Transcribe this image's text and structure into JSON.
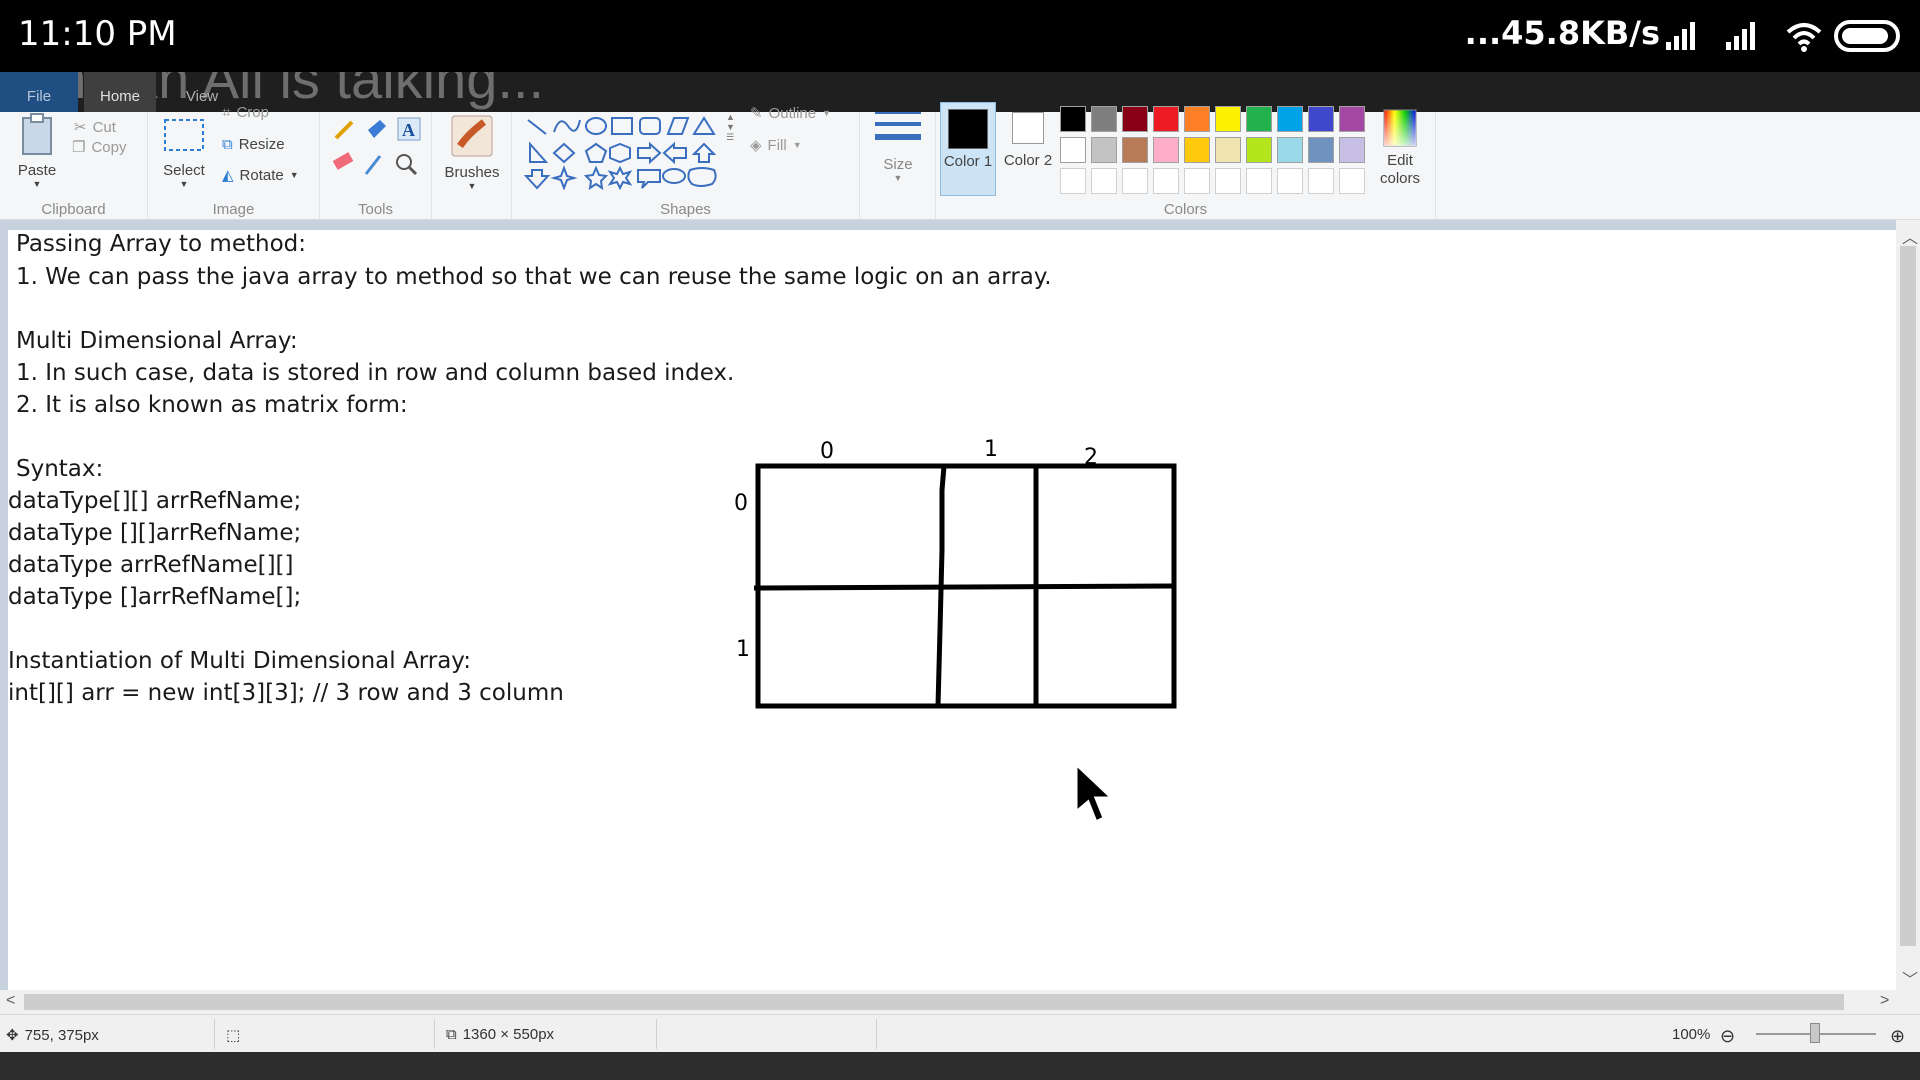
{
  "status_bar": {
    "time": "11:10 PM",
    "network_speed": "...45.8KB/s"
  },
  "ghost_banner": {
    "text": "Sheikh Ali is talking..."
  },
  "tabs": [
    {
      "label": "File"
    },
    {
      "label": "Home"
    },
    {
      "label": "View"
    }
  ],
  "ribbon": {
    "clipboard": {
      "paste": "Paste",
      "cut": "Cut",
      "copy": "Copy",
      "group": "Clipboard"
    },
    "image": {
      "select": "Select",
      "crop": "Crop",
      "resize": "Resize",
      "rotate": "Rotate",
      "group": "Image"
    },
    "tools": {
      "group": "Tools"
    },
    "brushes": {
      "label": "Brushes"
    },
    "shapes": {
      "outline": "Outline",
      "fill": "Fill",
      "group": "Shapes"
    },
    "size": {
      "label": "Size"
    },
    "colors": {
      "color1": "Color 1",
      "color2": "Color 2",
      "edit": "Edit colors",
      "group": "Colors",
      "color1_value": "#000000",
      "color2_value": "#ffffff",
      "palette_row1": [
        "#000000",
        "#7f7f7f",
        "#880015",
        "#ed1c24",
        "#ff7f27",
        "#fff200",
        "#22b14c",
        "#00a2e8",
        "#3f48cc",
        "#a349a4"
      ],
      "palette_row2": [
        "#ffffff",
        "#c3c3c3",
        "#b97a57",
        "#ffaec9",
        "#ffc90e",
        "#efe4b0",
        "#b5e61d",
        "#99d9ea",
        "#7092be",
        "#c8bfe7"
      ]
    }
  },
  "canvas": {
    "lines": [
      "Passing Array to method:",
      "1. We can pass the java array to method so that we can reuse the same logic on an array.",
      "Multi Dimensional Array:",
      "1. In such case, data is stored in row and column based index.",
      "2. It is also known as matrix form:",
      "Syntax:",
      "dataType[][] arrRefName;",
      "dataType [][]arrRefName;",
      "dataType arrRefName[][]",
      "dataType []arrRefName[];",
      "Instantiation of Multi Dimensional Array:",
      "int[][] arr = new int[3][3]; // 3 row and 3 column"
    ],
    "matrix": {
      "col_labels": [
        "0",
        "1",
        "2"
      ],
      "row_labels": [
        "0",
        "1"
      ]
    }
  },
  "statusline": {
    "cursor_pos": "755, 375px",
    "canvas_size": "1360 × 550px",
    "zoom": "100%"
  }
}
